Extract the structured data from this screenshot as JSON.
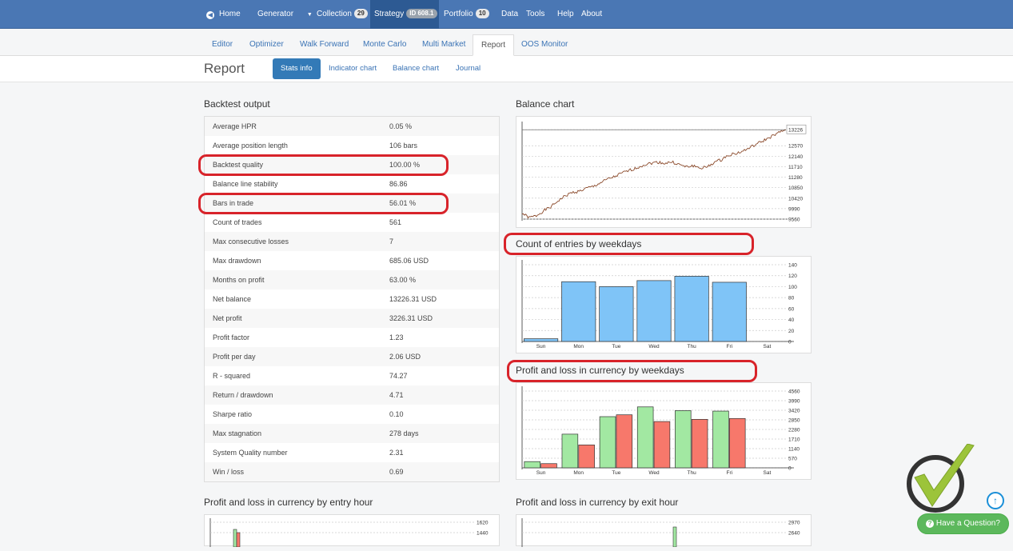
{
  "nav": {
    "home": "Home",
    "generator": "Generator",
    "collection": "Collection",
    "collection_count": "29",
    "strategy": "Strategy",
    "strategy_id": "ID 608.1",
    "portfolio": "Portfolio",
    "portfolio_count": "10",
    "data": "Data",
    "tools": "Tools",
    "help": "Help",
    "about": "About"
  },
  "subnav": [
    "Editor",
    "Optimizer",
    "Walk Forward",
    "Monte Carlo",
    "Multi Market",
    "Report",
    "OOS Monitor"
  ],
  "report": {
    "title": "Report",
    "pills": [
      "Stats info",
      "Indicator chart",
      "Balance chart",
      "Journal"
    ]
  },
  "backtest": {
    "title": "Backtest output",
    "rows": [
      {
        "label": "Average HPR",
        "value": "0.05 %"
      },
      {
        "label": "Average position length",
        "value": "106 bars"
      },
      {
        "label": "Backtest quality",
        "value": "100.00 %"
      },
      {
        "label": "Balance line stability",
        "value": "86.86"
      },
      {
        "label": "Bars in trade",
        "value": "56.01 %"
      },
      {
        "label": "Count of trades",
        "value": "561"
      },
      {
        "label": "Max consecutive losses",
        "value": "7"
      },
      {
        "label": "Max drawdown",
        "value": "685.06 USD"
      },
      {
        "label": "Months on profit",
        "value": "63.00 %"
      },
      {
        "label": "Net balance",
        "value": "13226.31 USD"
      },
      {
        "label": "Net profit",
        "value": "3226.31 USD"
      },
      {
        "label": "Profit factor",
        "value": "1.23"
      },
      {
        "label": "Profit per day",
        "value": "2.06 USD"
      },
      {
        "label": "R - squared",
        "value": "74.27"
      },
      {
        "label": "Return / drawdown",
        "value": "4.71"
      },
      {
        "label": "Sharpe ratio",
        "value": "0.10"
      },
      {
        "label": "Max stagnation",
        "value": "278 days"
      },
      {
        "label": "System Quality number",
        "value": "2.31"
      },
      {
        "label": "Win / loss",
        "value": "0.69"
      }
    ]
  },
  "titles": {
    "balance": "Balance chart",
    "entries": "Count of entries by weekdays",
    "pl_weekdays": "Profit and loss in currency by weekdays",
    "pl_entry_hour": "Profit and loss in currency by entry hour",
    "pl_exit_hour": "Profit and loss in currency by exit hour"
  },
  "help_button": "Have a Question?",
  "chart_data": [
    {
      "type": "line",
      "title": "Balance chart",
      "yticks": [
        "9560",
        "9990",
        "10420",
        "10850",
        "11280",
        "11710",
        "12140",
        "12570",
        "13226"
      ],
      "ylim": [
        9560,
        13430
      ],
      "current_value_label": "13226",
      "points": [
        9800,
        9620,
        9700,
        9900,
        10050,
        10300,
        10500,
        10650,
        10700,
        10820,
        10900,
        11050,
        11200,
        11300,
        11450,
        11550,
        11650,
        11780,
        11850,
        11900,
        11850,
        11900,
        11800,
        11700,
        11750,
        11650,
        11700,
        11900,
        12000,
        12200,
        12250,
        12350,
        12500,
        12650,
        12800,
        12950,
        13100,
        13226
      ],
      "color": "#8b4a2b"
    },
    {
      "type": "bar",
      "title": "Count of entries by weekdays",
      "categories": [
        "Sun",
        "Mon",
        "Tue",
        "Wed",
        "Thu",
        "Fri",
        "Sat"
      ],
      "values": [
        5,
        109,
        100,
        111,
        119,
        108,
        0
      ],
      "ylim": [
        0,
        140
      ],
      "yticks": [
        "0",
        "20",
        "40",
        "60",
        "80",
        "100",
        "120",
        "140"
      ],
      "color": "#7fc4f7"
    },
    {
      "type": "bar",
      "title": "Profit and loss in currency by weekdays",
      "categories": [
        "Sun",
        "Mon",
        "Tue",
        "Wed",
        "Thu",
        "Fri",
        "Sat"
      ],
      "series": [
        {
          "color": "#a2e8a2",
          "values": [
            370,
            2000,
            3040,
            3620,
            3400,
            3370,
            0
          ]
        },
        {
          "color": "#f7786b",
          "values": [
            250,
            1360,
            3150,
            2750,
            2880,
            2930,
            0
          ]
        }
      ],
      "ylim": [
        0,
        4560
      ],
      "yticks": [
        "0",
        "570",
        "1140",
        "1710",
        "2280",
        "2850",
        "3420",
        "3990",
        "4560"
      ]
    },
    {
      "type": "bar",
      "title": "Profit and loss in currency by entry hour",
      "yticks": [
        "1440",
        "1620"
      ]
    },
    {
      "type": "bar",
      "title": "Profit and loss in currency by exit hour",
      "yticks": [
        "2640",
        "2970"
      ]
    }
  ]
}
